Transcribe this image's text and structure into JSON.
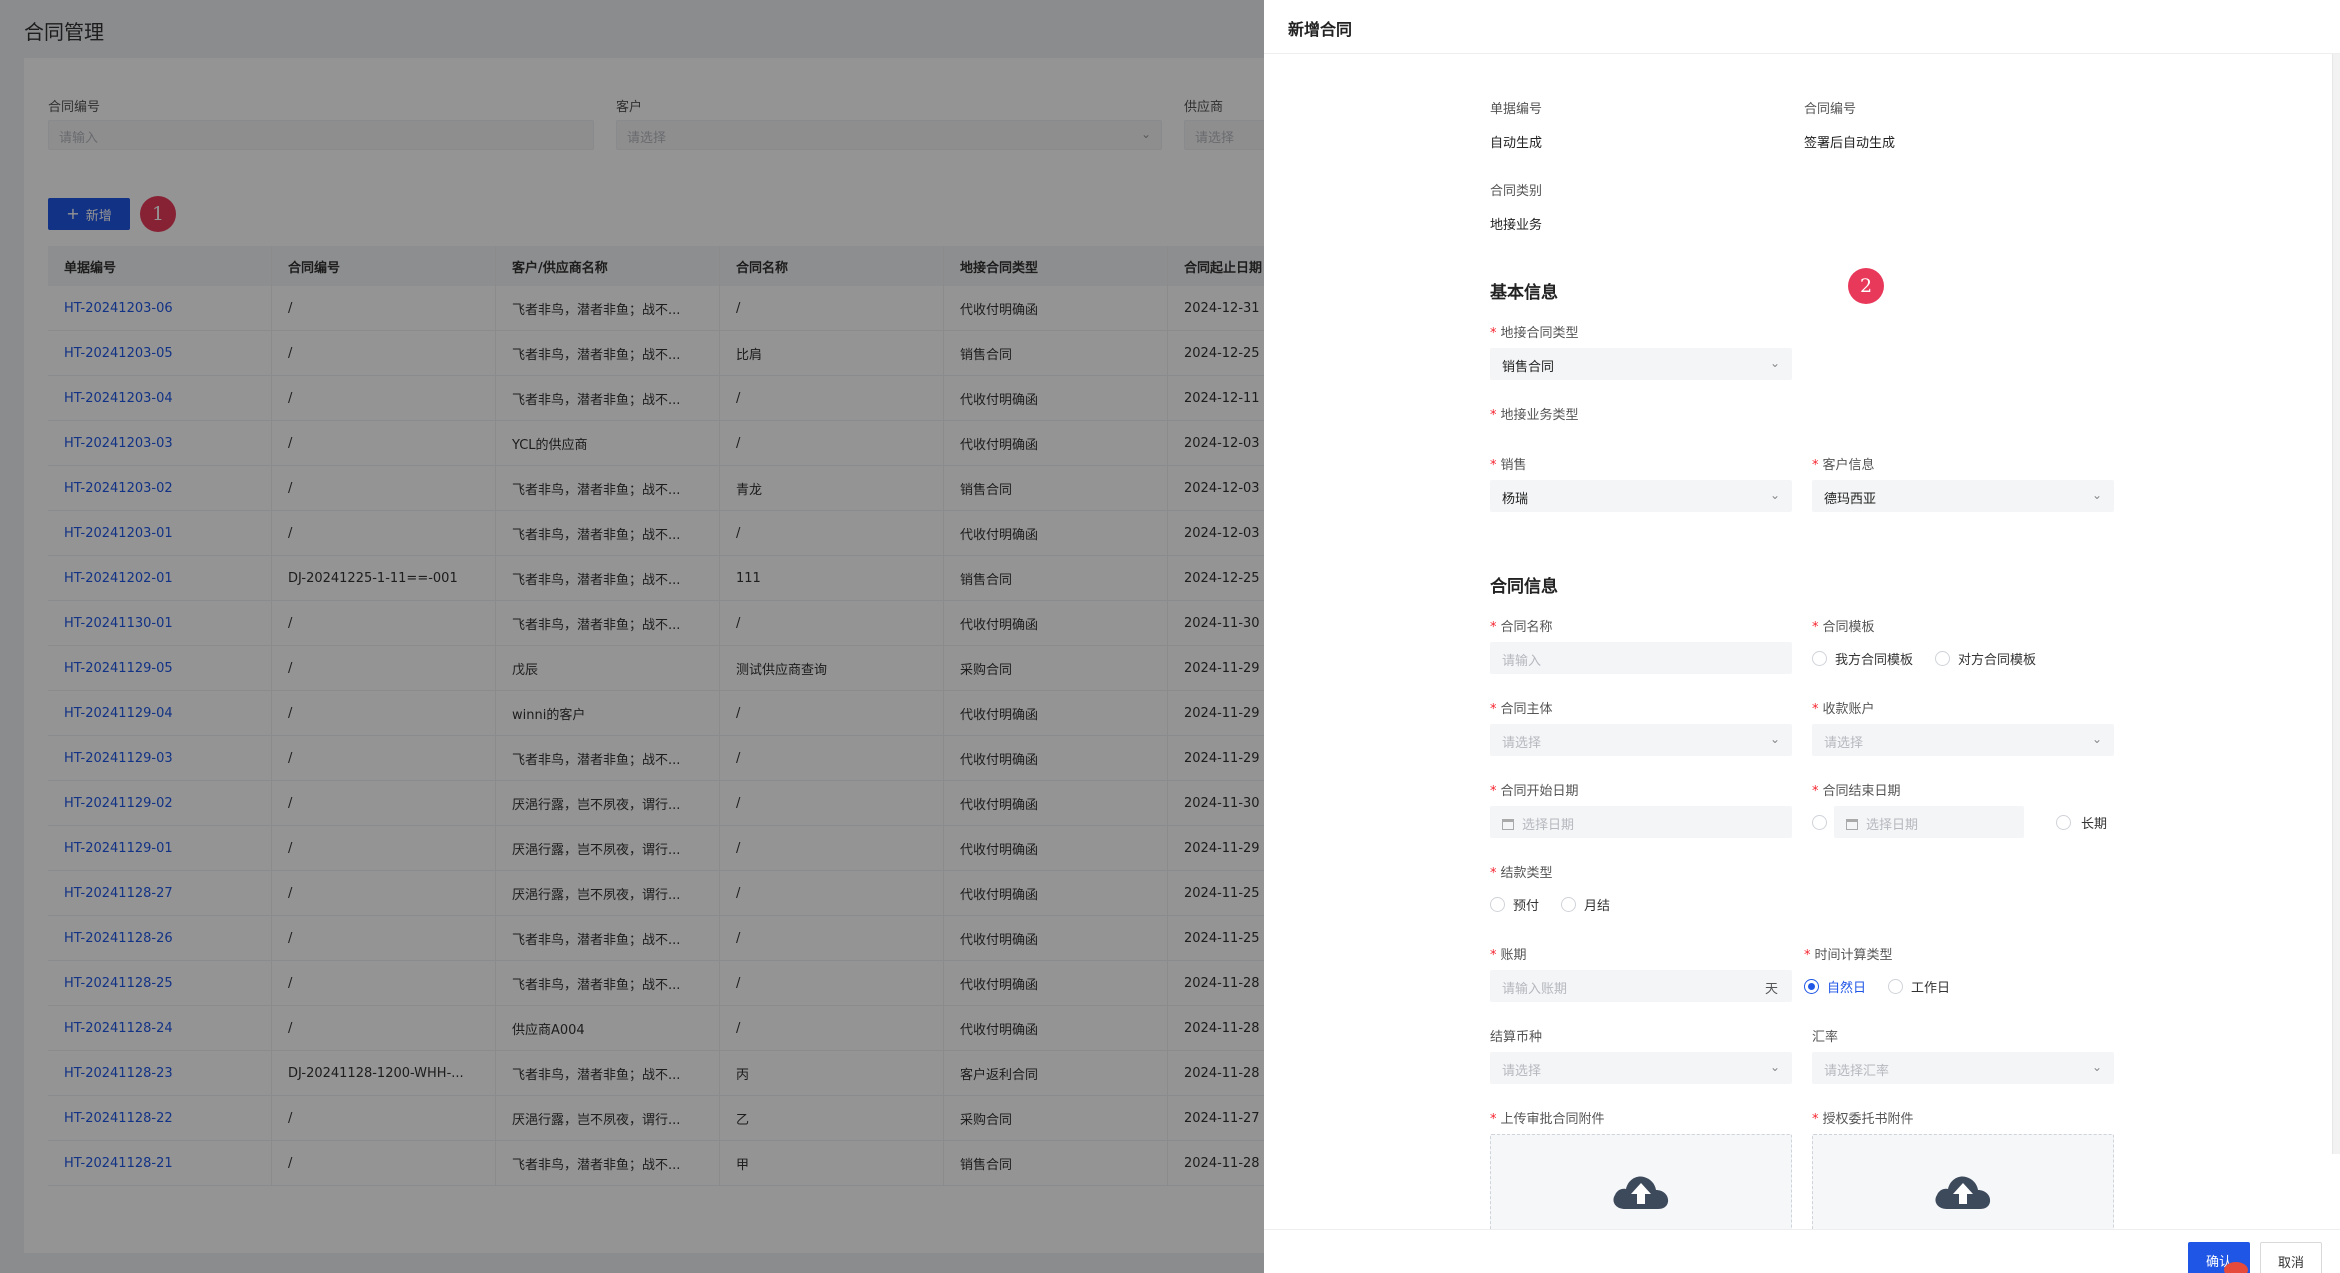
{
  "page": {
    "title": "合同管理"
  },
  "filters": [
    {
      "label": "合同编号",
      "placeholder": "请输入",
      "type": "input"
    },
    {
      "label": "客户",
      "placeholder": "请选择",
      "type": "select"
    },
    {
      "label": "供应商",
      "placeholder": "请选择",
      "type": "select"
    }
  ],
  "toolbar": {
    "add_label": "新增",
    "add_icon": "plus-icon",
    "badge": "1"
  },
  "table": {
    "columns": [
      "单据编号",
      "合同编号",
      "客户/供应商名称",
      "合同名称",
      "地接合同类型",
      "合同起止日期"
    ],
    "rows": [
      [
        "HT-20241203-06",
        "/",
        "飞者非鸟，潜者非鱼；战不...",
        "/",
        "代收付明确函",
        "2024-12-31"
      ],
      [
        "HT-20241203-05",
        "/",
        "飞者非鸟，潜者非鱼；战不...",
        "比肩",
        "销售合同",
        "2024-12-25"
      ],
      [
        "HT-20241203-04",
        "/",
        "飞者非鸟，潜者非鱼；战不...",
        "/",
        "代收付明确函",
        "2024-12-11"
      ],
      [
        "HT-20241203-03",
        "/",
        "YCL的供应商",
        "/",
        "代收付明确函",
        "2024-12-03"
      ],
      [
        "HT-20241203-02",
        "/",
        "飞者非鸟，潜者非鱼；战不...",
        "青龙",
        "销售合同",
        "2024-12-03"
      ],
      [
        "HT-20241203-01",
        "/",
        "飞者非鸟，潜者非鱼；战不...",
        "/",
        "代收付明确函",
        "2024-12-03"
      ],
      [
        "HT-20241202-01",
        "DJ-20241225-1-11==-001",
        "飞者非鸟，潜者非鱼；战不...",
        "111",
        "销售合同",
        "2024-12-25"
      ],
      [
        "HT-20241130-01",
        "/",
        "飞者非鸟，潜者非鱼；战不...",
        "/",
        "代收付明确函",
        "2024-11-30"
      ],
      [
        "HT-20241129-05",
        "/",
        "戊辰",
        "测试供应商查询",
        "采购合同",
        "2024-11-29"
      ],
      [
        "HT-20241129-04",
        "/",
        "winni的客户",
        "/",
        "代收付明确函",
        "2024-11-29"
      ],
      [
        "HT-20241129-03",
        "/",
        "飞者非鸟，潜者非鱼；战不...",
        "/",
        "代收付明确函",
        "2024-11-29"
      ],
      [
        "HT-20241129-02",
        "/",
        "厌浥行露，岂不夙夜，谓行...",
        "/",
        "代收付明确函",
        "2024-11-30"
      ],
      [
        "HT-20241129-01",
        "/",
        "厌浥行露，岂不夙夜，谓行...",
        "/",
        "代收付明确函",
        "2024-11-29"
      ],
      [
        "HT-20241128-27",
        "/",
        "厌浥行露，岂不夙夜，谓行...",
        "/",
        "代收付明确函",
        "2024-11-25"
      ],
      [
        "HT-20241128-26",
        "/",
        "飞者非鸟，潜者非鱼；战不...",
        "/",
        "代收付明确函",
        "2024-11-25"
      ],
      [
        "HT-20241128-25",
        "/",
        "飞者非鸟，潜者非鱼；战不...",
        "/",
        "代收付明确函",
        "2024-11-28"
      ],
      [
        "HT-20241128-24",
        "/",
        "供应商A004",
        "/",
        "代收付明确函",
        "2024-11-28"
      ],
      [
        "HT-20241128-23",
        "DJ-20241128-1200-WHH-...",
        "飞者非鸟，潜者非鱼；战不...",
        "丙",
        "客户返利合同",
        "2024-11-28"
      ],
      [
        "HT-20241128-22",
        "/",
        "厌浥行露，岂不夙夜，谓行...",
        "乙",
        "采购合同",
        "2024-11-27"
      ],
      [
        "HT-20241128-21",
        "/",
        "飞者非鸟，潜者非鱼；战不...",
        "甲",
        "销售合同",
        "2024-11-28"
      ]
    ]
  },
  "drawer": {
    "title": "新增合同",
    "badge": "2",
    "doc_no": {
      "label": "单据编号",
      "value": "自动生成"
    },
    "contract_no": {
      "label": "合同编号",
      "value": "签署后自动生成"
    },
    "category": {
      "label": "合同类别",
      "value": "地接业务"
    },
    "basic_section": "基本信息",
    "contract_type": {
      "label": "地接合同类型",
      "value": "销售合同"
    },
    "business_type": {
      "label": "地接业务类型"
    },
    "sales": {
      "label": "销售",
      "value": "杨瑞"
    },
    "customer": {
      "label": "客户信息",
      "value": "德玛西亚"
    },
    "contract_section": "合同信息",
    "contract_name": {
      "label": "合同名称",
      "placeholder": "请输入"
    },
    "template": {
      "label": "合同模板",
      "options": [
        "我方合同模板",
        "对方合同模板"
      ]
    },
    "entity": {
      "label": "合同主体",
      "placeholder": "请选择"
    },
    "account": {
      "label": "收款账户",
      "placeholder": "请选择"
    },
    "start_date": {
      "label": "合同开始日期",
      "placeholder": "选择日期"
    },
    "end_date": {
      "label": "合同结束日期",
      "placeholder": "选择日期",
      "long_term": "长期"
    },
    "settle_type": {
      "label": "结款类型",
      "options": [
        "预付",
        "月结"
      ]
    },
    "period": {
      "label": "账期",
      "placeholder": "请输入账期",
      "suffix": "天"
    },
    "time_type": {
      "label": "时间计算类型",
      "options": [
        "自然日",
        "工作日"
      ],
      "selected": "自然日"
    },
    "currency": {
      "label": "结算币种",
      "placeholder": "请选择"
    },
    "rate": {
      "label": "汇率",
      "placeholder": "请选择汇率"
    },
    "upload_contract": {
      "label": "上传审批合同附件"
    },
    "upload_auth": {
      "label": "授权委托书附件"
    },
    "confirm_label": "确认",
    "cancel_label": "取消"
  },
  "colors": {
    "primary": "#1f56e6",
    "badge": "#e9395b",
    "required": "#f5222d"
  }
}
